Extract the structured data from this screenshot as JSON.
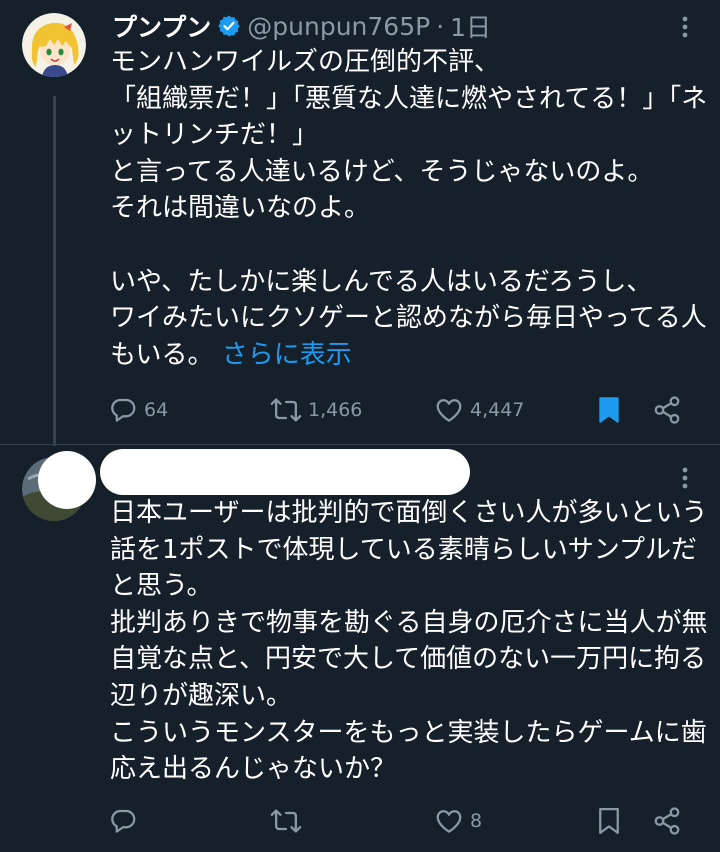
{
  "tweet1": {
    "display_name": "プンプン",
    "handle": "@punpun765P",
    "separator": "·",
    "time": "1日",
    "body_text": "モンハンワイルズの圧倒的不評、\n「組織票だ！」「悪質な人達に燃やされてる！」「ネットリンチだ！」\nと言ってる人達いるけど、そうじゃないのよ。\nそれは間違いなのよ。\n\nいや、たしかに楽しんでる人はいるだろうし、\nワイみたいにクソゲーと認めながら毎日やってる人もいる。",
    "show_more": "さらに表示",
    "replies": "64",
    "retweets": "1,466",
    "likes": "4,447",
    "bookmarked": true
  },
  "tweet2": {
    "body_text": "日本ユーザーは批判的で面倒くさい人が多いという話を1ポストで体現している素晴らしいサンプルだと思う。\n批判ありきで物事を勘ぐる自身の厄介さに当人が無自覚な点と、円安で大して価値のない一万円に拘る辺りが趣深い。\nこういうモンスターをもっと実装したらゲームに歯応え出るんじゃないか？",
    "replies": "",
    "retweets": "",
    "likes": "8",
    "bookmarked": false
  },
  "colors": {
    "background": "#15202b",
    "text": "#ffffff",
    "secondary": "#8b98a5",
    "link": "#1d9bf0",
    "verified": "#1d9bf0",
    "divider": "#38444d"
  },
  "icons": [
    "verified-icon",
    "more-icon",
    "reply-icon",
    "retweet-icon",
    "like-icon",
    "bookmark-icon",
    "share-icon"
  ]
}
